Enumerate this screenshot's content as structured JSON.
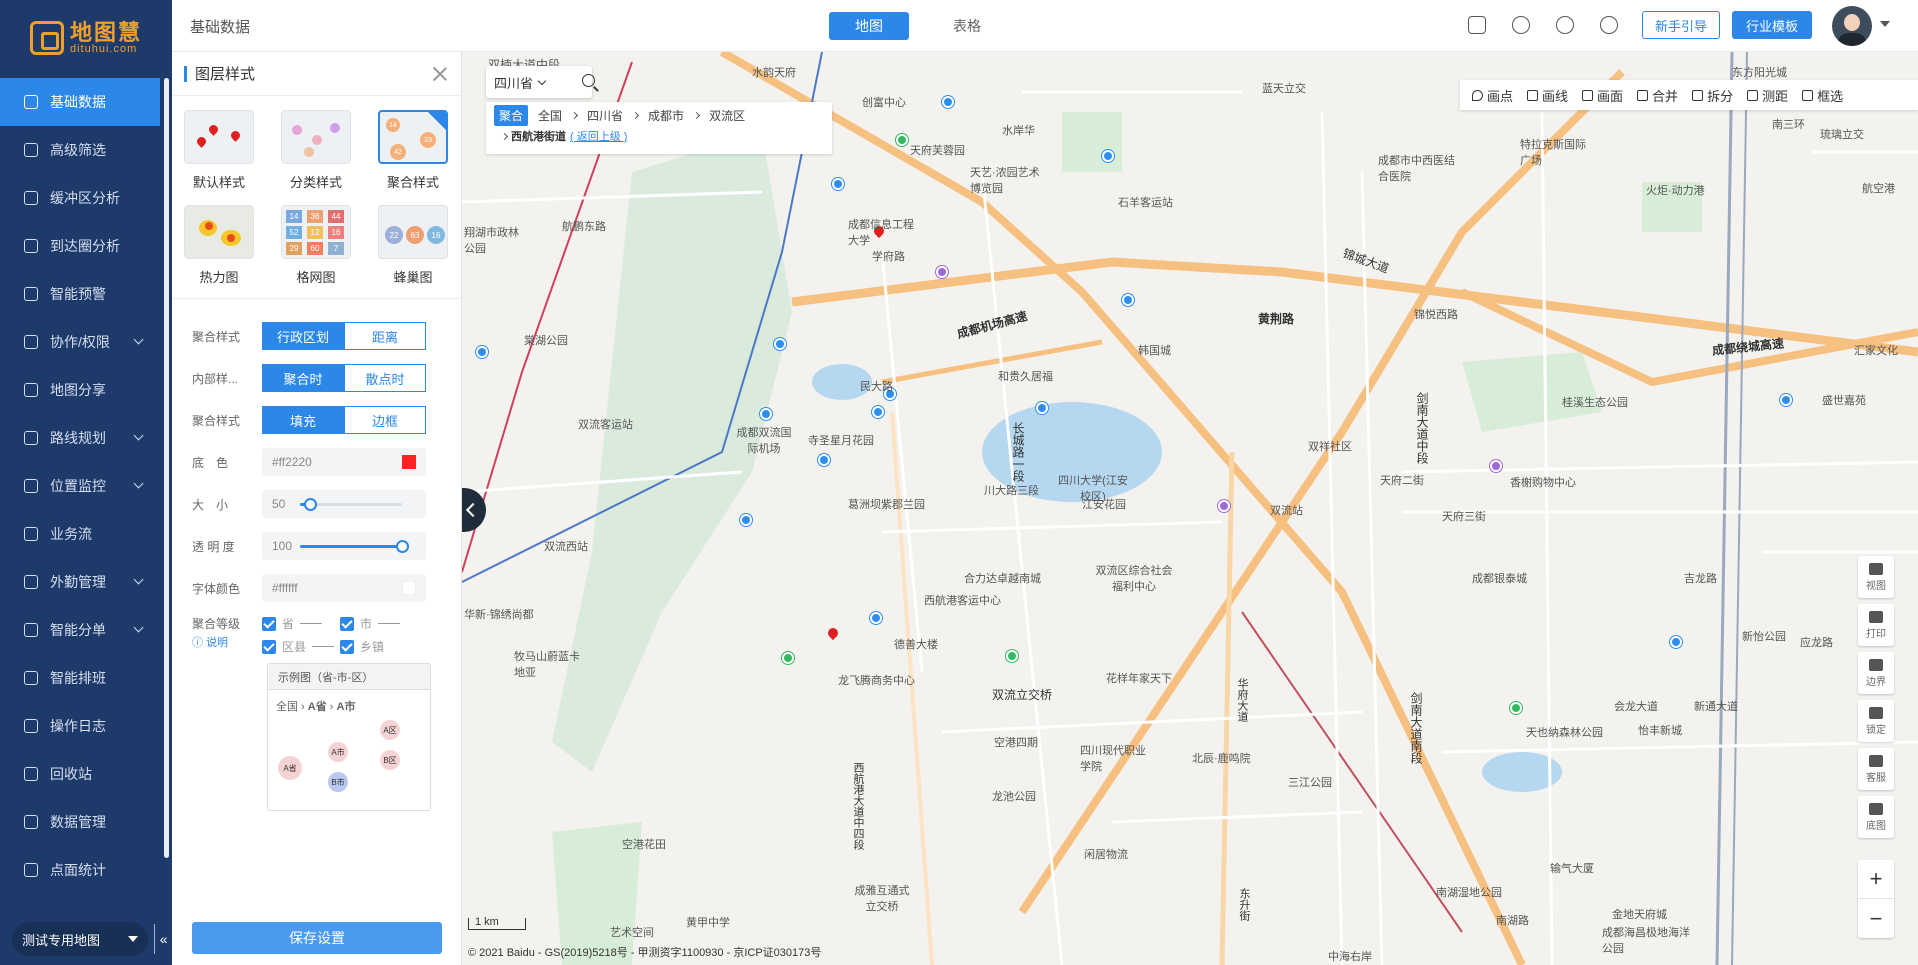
{
  "app": {
    "logo_title": "地图慧",
    "logo_sub": "dituhui.com"
  },
  "sidebar": {
    "items": [
      {
        "label": "基础数据",
        "active": true,
        "arrow": false
      },
      {
        "label": "高级筛选",
        "arrow": false
      },
      {
        "label": "缓冲区分析",
        "arrow": false
      },
      {
        "label": "到达圈分析",
        "arrow": false
      },
      {
        "label": "智能预警",
        "arrow": false
      },
      {
        "label": "协作/权限",
        "arrow": true
      },
      {
        "label": "地图分享",
        "arrow": false
      },
      {
        "label": "路线规划",
        "arrow": true
      },
      {
        "label": "位置监控",
        "arrow": true
      },
      {
        "label": "业务流",
        "arrow": false
      },
      {
        "label": "外勤管理",
        "arrow": true
      },
      {
        "label": "智能分单",
        "arrow": true
      },
      {
        "label": "智能排班",
        "arrow": false
      },
      {
        "label": "操作日志",
        "arrow": false
      },
      {
        "label": "回收站",
        "arrow": false
      },
      {
        "label": "数据管理",
        "arrow": false
      },
      {
        "label": "点面统计",
        "arrow": false
      }
    ],
    "map_select": "测试专用地图",
    "collapse_label": "«"
  },
  "header": {
    "page_title": "基础数据",
    "tabs": [
      {
        "label": "地图",
        "active": true
      },
      {
        "label": "表格",
        "active": false
      }
    ],
    "guide_button": "新手引导",
    "template_button": "行业模板"
  },
  "panel": {
    "title": "图层样式",
    "styles": [
      {
        "label": "默认样式"
      },
      {
        "label": "分类样式"
      },
      {
        "label": "聚合样式",
        "selected": true
      },
      {
        "label": "热力图"
      },
      {
        "label": "格网图"
      },
      {
        "label": "蜂巢图"
      }
    ],
    "grid_numbers": [
      "14",
      "36",
      "44",
      "52",
      "12",
      "16",
      "29",
      "60",
      "7"
    ],
    "hex_numbers": [
      "22",
      "63",
      "16"
    ],
    "cluster_numbers": [
      "14",
      "42",
      "23"
    ],
    "form": {
      "cluster_style_label": "聚合样式",
      "cluster_style_options": [
        "行政区划",
        "距离"
      ],
      "inner_style_label": "内部样...",
      "inner_style_options": [
        "聚合时",
        "散点时"
      ],
      "fill_style_label": "聚合样式",
      "fill_style_options": [
        "填充",
        "边框"
      ],
      "bg_color_label": "底　色",
      "bg_color_value": "#ff2220",
      "bg_color_hex": "#ff2220",
      "size_label": "大　小",
      "size_value": "50",
      "size_fraction": 0.1,
      "opacity_label": "透 明 度",
      "opacity_value": "100",
      "opacity_fraction": 1.0,
      "font_color_label": "字体颜色",
      "font_color_value": "#ffffff",
      "level_label": "聚合等级",
      "help_label": "说明",
      "levels": [
        "省",
        "市",
        "区县",
        "乡镇"
      ],
      "example_title": "示例图（省-市-区）",
      "example_crumbs": [
        "全国",
        "A省",
        "A市"
      ],
      "example_bubbles": [
        "A省",
        "A市",
        "B市",
        "A区",
        "B区"
      ]
    },
    "save_button": "保存设置"
  },
  "map": {
    "province_select": "四川省",
    "crumb_tag": "聚合",
    "crumbs": [
      "全国",
      "四川省",
      "成都市",
      "双流区"
    ],
    "sub_crumb": "西航港街道",
    "back_link": "( 返回上级 )",
    "toolbar": [
      "画点",
      "画线",
      "画面",
      "合并",
      "拆分",
      "测距",
      "框选"
    ],
    "right_tools": [
      "视图",
      "打印",
      "边界",
      "锁定",
      "客服",
      "底图"
    ],
    "zoom_in": "+",
    "zoom_out": "−",
    "scale_label": "1 km",
    "copyright": "© 2021 Baidu - GS(2019)5218号 - 甲测资字1100930 - 京ICP证030173号",
    "labels": [
      "双楠大道中段",
      "水韵天府",
      "创富中心",
      "水岸华",
      "蓝天立交",
      "东方阳光城",
      "南三环",
      "琉璃立交",
      "天府芙蓉园",
      "天艺·浓园艺术博览园",
      "成都市中西医结合医院",
      "特拉克斯国际广场",
      "火炬·动力港",
      "航空港",
      "石羊客运站",
      "成都信息工程大学",
      "学府路",
      "航鹏东路",
      "翔湖市政林公园",
      "棠湖公园",
      "成都机场高速",
      "韩国城",
      "黄荆路",
      "锦城大道",
      "锦悦西路",
      "成都绕城高速",
      "汇家文化",
      "桂溪生态公园",
      "盛世嘉苑",
      "民大路",
      "和贵久居福",
      "长城路一段",
      "四川大学(江安校区)",
      "剑南大道中段",
      "双流客运站",
      "成都双流国际机场",
      "寺圣星月花园",
      "双祥社区",
      "天府二街",
      "天府三街",
      "香榭购物中心",
      "川大路三段",
      "江安花园",
      "葛洲坝紫郡兰园",
      "双流站",
      "双流西站",
      "双流区综合社会福利中心",
      "合力达卓越南城",
      "西航港客运中心",
      "成都银泰城",
      "吉龙路",
      "华新·锦绣尚都",
      "德善大楼",
      "新怡公园",
      "应龙路",
      "牧马山蔚蓝卡地亚",
      "龙飞腾商务中心",
      "花样年家天下",
      "双流立交桥",
      "会龙大道",
      "新通大道",
      "空港四期",
      "四川现代职业学院",
      "北辰·鹿鸣院",
      "天也纳森林公园",
      "怡丰新城",
      "三江公园",
      "龙池公园",
      "空港花田",
      "闲居物流",
      "输气大厦",
      "南湖湿地公园",
      "成雅互通式立交桥",
      "黄甲中学",
      "艺术空间",
      "金地天府城",
      "成都海昌极地海洋公园",
      "中海右岸",
      "南湖路",
      "西航港大道中四段",
      "剑南大道南段",
      "华府大道",
      "东升街"
    ]
  }
}
